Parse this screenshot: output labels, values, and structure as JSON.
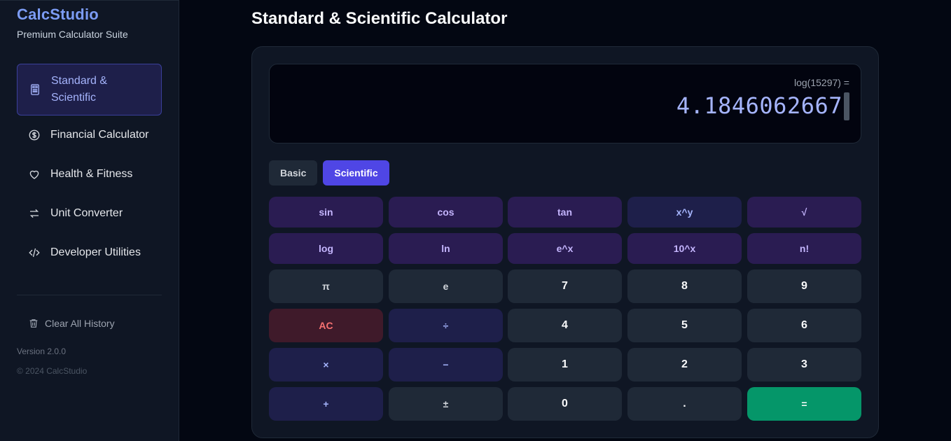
{
  "brand": {
    "title": "CalcStudio",
    "subtitle": "Premium Calculator Suite"
  },
  "nav": [
    {
      "label": "Standard & Scientific",
      "icon": "calculator-icon",
      "active": true
    },
    {
      "label": "Financial Calculator",
      "icon": "dollar-icon"
    },
    {
      "label": "Health & Fitness",
      "icon": "heart-icon"
    },
    {
      "label": "Unit Converter",
      "icon": "arrows-swap-icon"
    },
    {
      "label": "Developer Utilities",
      "icon": "code-icon"
    }
  ],
  "sidebar_footer": {
    "clear_history": "Clear All History",
    "version": "Version 2.0.0",
    "copyright": "© 2024 CalcStudio"
  },
  "page": {
    "title": "Standard & Scientific Calculator"
  },
  "display": {
    "expression": "log(15297) =",
    "result": "4.1846062667"
  },
  "mode_tabs": [
    {
      "label": "Basic",
      "active": false
    },
    {
      "label": "Scientific",
      "active": true
    }
  ],
  "keys": [
    [
      "sin",
      "cos",
      "tan",
      "x^y",
      "√"
    ],
    [
      "log",
      "ln",
      "e^x",
      "10^x",
      "n!"
    ],
    [
      "π",
      "e",
      "7",
      "8",
      "9"
    ],
    [
      "AC",
      "÷",
      "4",
      "5",
      "6"
    ],
    [
      "×",
      "−",
      "1",
      "2",
      "3"
    ],
    [
      "+",
      "±",
      "0",
      ".",
      "="
    ]
  ],
  "colors": {
    "accent": "#4f46e5",
    "brand": "#7c9cf5",
    "equals": "#059669",
    "clear": "#f87171"
  }
}
